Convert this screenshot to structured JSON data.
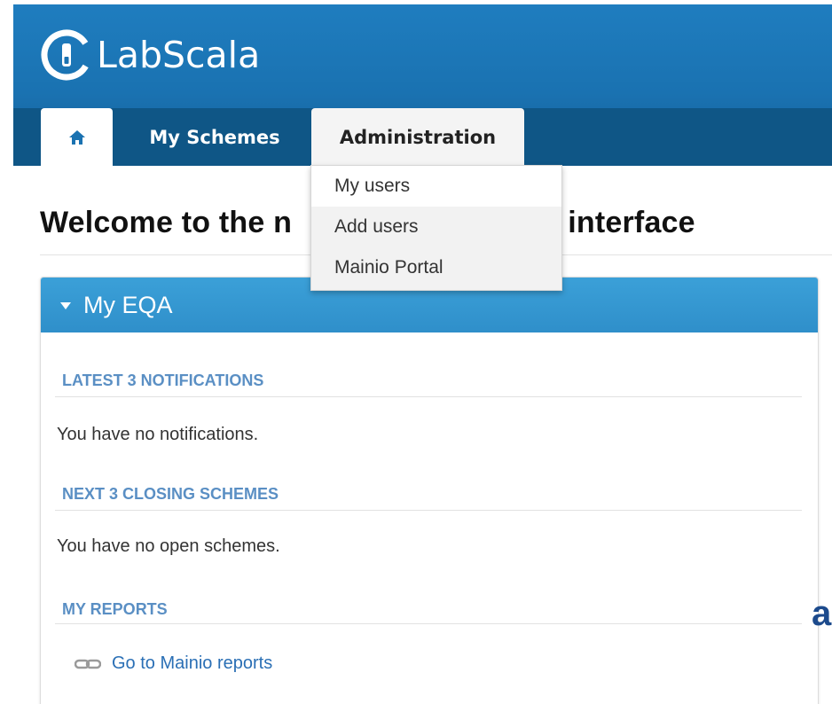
{
  "app": {
    "name": "LabScala",
    "brand_color": "#1a72b1",
    "nav_color": "#0f5686"
  },
  "nav": {
    "home_icon": "home-icon",
    "tabs": [
      {
        "label": "My Schemes"
      },
      {
        "label": "Administration"
      }
    ]
  },
  "dropdown": {
    "items": [
      {
        "label": "My users"
      },
      {
        "label": "Add users"
      },
      {
        "label": "Mainio Portal"
      }
    ]
  },
  "main": {
    "title_left": "Welcome to the n",
    "title_right": "er interface"
  },
  "panel": {
    "title": "My EQA",
    "header_color": "#3399d3",
    "sections": [
      {
        "heading": "LATEST 3 NOTIFICATIONS",
        "text": "You have no notifications."
      },
      {
        "heading": "NEXT 3 CLOSING SCHEMES",
        "text": "You have no open schemes."
      },
      {
        "heading": "MY REPORTS",
        "link": "Go to Mainio reports",
        "link_icon": "link-icon"
      }
    ]
  },
  "edge_text": "a"
}
